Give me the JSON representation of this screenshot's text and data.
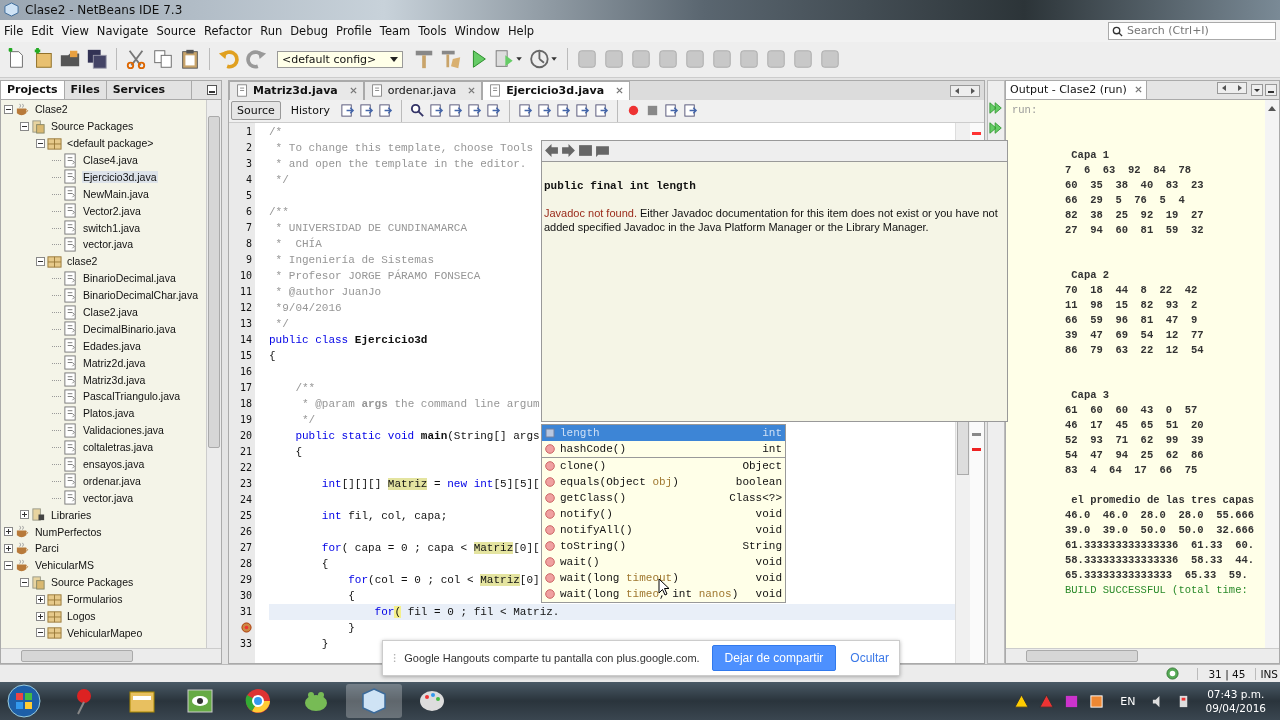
{
  "window": {
    "title": "Clase2 - NetBeans IDE 7.3"
  },
  "menu": [
    "File",
    "Edit",
    "View",
    "Navigate",
    "Source",
    "Refactor",
    "Run",
    "Debug",
    "Profile",
    "Team",
    "Tools",
    "Window",
    "Help"
  ],
  "search": {
    "placeholder": "Search (Ctrl+I)"
  },
  "toolbar": {
    "config": "<default config>"
  },
  "side_tabs": [
    {
      "label": "Projects",
      "selected": true
    },
    {
      "label": "Files",
      "selected": false
    },
    {
      "label": "Services",
      "selected": false
    }
  ],
  "tree": [
    {
      "label": "Clase2",
      "kind": "project",
      "expanded": true,
      "selected": false,
      "children": [
        {
          "label": "Source Packages",
          "kind": "sources",
          "expanded": true,
          "selected": false,
          "children": [
            {
              "label": "<default package>",
              "kind": "package",
              "expanded": true,
              "selected": false,
              "children": [
                {
                  "label": "Clase4.java",
                  "kind": "java",
                  "selected": false
                },
                {
                  "label": "Ejercicio3d.java",
                  "kind": "java",
                  "selected": true
                },
                {
                  "label": "NewMain.java",
                  "kind": "java",
                  "selected": false
                },
                {
                  "label": "Vector2.java",
                  "kind": "java",
                  "selected": false
                },
                {
                  "label": "switch1.java",
                  "kind": "java",
                  "selected": false
                },
                {
                  "label": "vector.java",
                  "kind": "java",
                  "selected": false
                }
              ]
            },
            {
              "label": "clase2",
              "kind": "package",
              "expanded": true,
              "selected": false,
              "children": [
                {
                  "label": "BinarioDecimal.java",
                  "kind": "java",
                  "selected": false
                },
                {
                  "label": "BinarioDecimalChar.java",
                  "kind": "java",
                  "selected": false
                },
                {
                  "label": "Clase2.java",
                  "kind": "java",
                  "selected": false
                },
                {
                  "label": "DecimalBinario.java",
                  "kind": "java",
                  "selected": false
                },
                {
                  "label": "Edades.java",
                  "kind": "java",
                  "selected": false
                },
                {
                  "label": "Matriz2d.java",
                  "kind": "java",
                  "selected": false
                },
                {
                  "label": "Matriz3d.java",
                  "kind": "java",
                  "selected": false
                },
                {
                  "label": "PascalTriangulo.java",
                  "kind": "java",
                  "selected": false
                },
                {
                  "label": "Platos.java",
                  "kind": "java",
                  "selected": false
                },
                {
                  "label": "Validaciones.java",
                  "kind": "java",
                  "selected": false
                },
                {
                  "label": "coltaletras.java",
                  "kind": "java",
                  "selected": false
                },
                {
                  "label": "ensayos.java",
                  "kind": "java",
                  "selected": false
                },
                {
                  "label": "ordenar.java",
                  "kind": "java",
                  "selected": false
                },
                {
                  "label": "vector.java",
                  "kind": "java",
                  "selected": false
                }
              ]
            }
          ]
        },
        {
          "label": "Libraries",
          "kind": "library",
          "expanded": false,
          "selected": false
        }
      ]
    },
    {
      "label": "NumPerfectos",
      "kind": "project",
      "expanded": false,
      "selected": false
    },
    {
      "label": "Parci",
      "kind": "project",
      "expanded": false,
      "selected": false
    },
    {
      "label": "VehicularMS",
      "kind": "project",
      "expanded": true,
      "selected": false,
      "children": [
        {
          "label": "Source Packages",
          "kind": "sources",
          "expanded": true,
          "selected": false,
          "children": [
            {
              "label": "Formularios",
              "kind": "package",
              "expanded": false,
              "selected": false
            },
            {
              "label": "Logos",
              "kind": "package",
              "expanded": false,
              "selected": false
            },
            {
              "label": "VehicularMapeo",
              "kind": "package",
              "expanded": true,
              "selected": false
            }
          ]
        }
      ]
    }
  ],
  "editor_tabs": [
    {
      "label": "Matriz3d.java",
      "selected": false
    },
    {
      "label": "ordenar.java",
      "selected": false
    },
    {
      "label": "Ejercicio3d.java",
      "selected": true
    }
  ],
  "view_tabs": [
    {
      "label": "Source",
      "selected": true
    },
    {
      "label": "History",
      "selected": false
    }
  ],
  "code": [
    {
      "number": "1",
      "error": false,
      "current": false,
      "tokens": [
        {
          "text": "/*",
          "kind": "comment"
        }
      ]
    },
    {
      "number": "2",
      "error": false,
      "current": false,
      "tokens": [
        {
          "text": " * To change this template, choose Tools",
          "kind": "comment"
        }
      ]
    },
    {
      "number": "3",
      "error": false,
      "current": false,
      "tokens": [
        {
          "text": " * and open the template in the editor.",
          "kind": "comment"
        }
      ]
    },
    {
      "number": "4",
      "error": false,
      "current": false,
      "tokens": [
        {
          "text": " */",
          "kind": "comment"
        }
      ]
    },
    {
      "number": "5",
      "error": false,
      "current": false
    },
    {
      "number": "6",
      "error": false,
      "current": false,
      "tokens": [
        {
          "text": "/**",
          "kind": "comment"
        }
      ]
    },
    {
      "number": "7",
      "error": false,
      "current": false,
      "tokens": [
        {
          "text": " * UNIVERSIDAD DE CUNDINAMARCA",
          "kind": "comment"
        }
      ]
    },
    {
      "number": "8",
      "error": false,
      "current": false,
      "tokens": [
        {
          "text": " *  CHÍA",
          "kind": "comment"
        }
      ]
    },
    {
      "number": "9",
      "error": false,
      "current": false,
      "tokens": [
        {
          "text": " * Ingeniería de Sistemas",
          "kind": "comment"
        }
      ]
    },
    {
      "number": "10",
      "error": false,
      "current": false,
      "tokens": [
        {
          "text": " * Profesor JORGE PÁRAMO FONSECA",
          "kind": "comment"
        }
      ]
    },
    {
      "number": "11",
      "error": false,
      "current": false,
      "tokens": [
        {
          "text": " * @author JuanJo",
          "kind": "comment"
        }
      ]
    },
    {
      "number": "12",
      "error": false,
      "current": false,
      "tokens": [
        {
          "text": " *9/04/2016",
          "kind": "comment"
        }
      ]
    },
    {
      "number": "13",
      "error": false,
      "current": false,
      "tokens": [
        {
          "text": " */",
          "kind": "comment"
        }
      ]
    },
    {
      "number": "14",
      "error": false,
      "current": false,
      "tokens": [
        {
          "text": "public class ",
          "kind": "keyword"
        },
        {
          "text": "Ejercicio3d",
          "kind": "bold"
        }
      ]
    },
    {
      "number": "15",
      "error": false,
      "current": false,
      "tokens": [
        {
          "text": "{",
          "kind": "plain"
        }
      ]
    },
    {
      "number": "16",
      "error": false,
      "current": false
    },
    {
      "number": "17",
      "error": false,
      "current": false,
      "tokens": [
        {
          "text": "    /**",
          "kind": "comment"
        }
      ]
    },
    {
      "number": "18",
      "error": false,
      "current": false,
      "tokens": [
        {
          "text": "     * @param ",
          "kind": "comment"
        },
        {
          "text": "args",
          "kind": "comment_bold"
        },
        {
          "text": " the command line argum",
          "kind": "comment"
        }
      ]
    },
    {
      "number": "19",
      "error": false,
      "current": false,
      "tokens": [
        {
          "text": "     */",
          "kind": "comment"
        }
      ]
    },
    {
      "number": "20",
      "error": false,
      "current": false,
      "tokens": [
        {
          "text": "    public static void ",
          "kind": "keyword"
        },
        {
          "text": "main",
          "kind": "bold"
        },
        {
          "text": "(String[] args",
          "kind": "plain"
        }
      ]
    },
    {
      "number": "21",
      "error": false,
      "current": false,
      "tokens": [
        {
          "text": "    {",
          "kind": "plain"
        }
      ]
    },
    {
      "number": "22",
      "error": false,
      "current": false
    },
    {
      "number": "23",
      "error": false,
      "current": false,
      "tokens": [
        {
          "text": "        int",
          "kind": "keyword"
        },
        {
          "text": "[][][] ",
          "kind": "plain"
        },
        {
          "text": "Matriz",
          "kind": "mark"
        },
        {
          "text": " = ",
          "kind": "plain"
        },
        {
          "text": "new int",
          "kind": "keyword"
        },
        {
          "text": "[5][5][",
          "kind": "plain"
        }
      ]
    },
    {
      "number": "24",
      "error": false,
      "current": false
    },
    {
      "number": "25",
      "error": false,
      "current": false,
      "tokens": [
        {
          "text": "        int",
          "kind": "keyword"
        },
        {
          "text": " fil, col, capa;",
          "kind": "plain"
        }
      ]
    },
    {
      "number": "26",
      "error": false,
      "current": false
    },
    {
      "number": "27",
      "error": false,
      "current": false,
      "tokens": [
        {
          "text": "        for",
          "kind": "keyword"
        },
        {
          "text": "( capa = 0 ; capa < ",
          "kind": "plain"
        },
        {
          "text": "Matriz",
          "kind": "mark"
        },
        {
          "text": "[0][",
          "kind": "plain"
        }
      ]
    },
    {
      "number": "28",
      "error": false,
      "current": false,
      "tokens": [
        {
          "text": "        {",
          "kind": "plain"
        }
      ]
    },
    {
      "number": "29",
      "error": false,
      "current": false,
      "tokens": [
        {
          "text": "            for",
          "kind": "keyword"
        },
        {
          "text": "(col = 0 ; col < ",
          "kind": "plain"
        },
        {
          "text": "Matriz",
          "kind": "mark"
        },
        {
          "text": "[0]",
          "kind": "plain"
        }
      ]
    },
    {
      "number": "30",
      "error": false,
      "current": false,
      "tokens": [
        {
          "text": "            {",
          "kind": "plain"
        }
      ]
    },
    {
      "number": "31",
      "error": false,
      "current": true,
      "tokens": [
        {
          "text": "                for",
          "kind": "keyword"
        },
        {
          "text": "(",
          "kind": "bracket"
        },
        {
          "text": " fil = 0 ; fil < Matriz.",
          "kind": "plain"
        }
      ]
    },
    {
      "error": true,
      "current": false,
      "tokens": [
        {
          "text": "            }",
          "kind": "plain"
        }
      ]
    },
    {
      "number": "33",
      "error": false,
      "current": false,
      "tokens": [
        {
          "text": "        }",
          "kind": "plain"
        }
      ]
    }
  ],
  "javadoc": {
    "signature": "public final int length",
    "warning": "Javadoc not found.",
    "message": "Either Javadoc documentation for this item does not exist or you have not added specified Javadoc in the Java Platform Manager or the Library Manager."
  },
  "completion": [
    {
      "kind": "field",
      "parts": [
        {
          "text": "length",
          "kind": "name"
        }
      ],
      "type": "int",
      "selected": true
    },
    {
      "kind": "method",
      "parts": [
        {
          "text": "hashCode()",
          "kind": "name"
        }
      ],
      "type": "int",
      "selected": false
    },
    {
      "kind": "method",
      "parts": [
        {
          "text": "clone()",
          "kind": "name"
        }
      ],
      "type": "Object",
      "selected": false
    },
    {
      "kind": "method",
      "parts": [
        {
          "text": "equals(Object ",
          "kind": "name"
        },
        {
          "text": "obj",
          "kind": "param"
        },
        {
          "text": ")",
          "kind": "name"
        }
      ],
      "type": "boolean",
      "selected": false
    },
    {
      "kind": "method",
      "parts": [
        {
          "text": "getClass()",
          "kind": "name"
        }
      ],
      "type": "Class<?>",
      "selected": false
    },
    {
      "kind": "method",
      "parts": [
        {
          "text": "notify()",
          "kind": "name"
        }
      ],
      "type": "void",
      "selected": false
    },
    {
      "kind": "method",
      "parts": [
        {
          "text": "notifyAll()",
          "kind": "name"
        }
      ],
      "type": "void",
      "selected": false
    },
    {
      "kind": "method",
      "parts": [
        {
          "text": "toString()",
          "kind": "name"
        }
      ],
      "type": "String",
      "selected": false
    },
    {
      "kind": "method",
      "parts": [
        {
          "text": "wait()",
          "kind": "name"
        }
      ],
      "type": "void",
      "selected": false
    },
    {
      "kind": "method",
      "parts": [
        {
          "text": "wait(long ",
          "kind": "name"
        },
        {
          "text": "timeout",
          "kind": "param"
        },
        {
          "text": ")",
          "kind": "name"
        }
      ],
      "type": "void",
      "selected": false
    },
    {
      "kind": "method",
      "parts": [
        {
          "text": "wait(long ",
          "kind": "name"
        },
        {
          "text": "timeo",
          "kind": "param"
        },
        {
          "text": ", int ",
          "kind": "name"
        },
        {
          "text": "nanos",
          "kind": "param"
        },
        {
          "text": ")",
          "kind": "name"
        }
      ],
      "type": "void",
      "selected": false
    }
  ],
  "output": {
    "tab": "Output - Clase2 (run)",
    "blocks": [
      {
        "kind": "log",
        "lines": [
          {
            "text": "run:",
            "kind": "normal"
          }
        ]
      },
      {
        "kind": "table",
        "lines": [
          {
            "text": " Capa 1",
            "kind": "normal"
          },
          {
            "text": "7  6  63  92  84  78",
            "kind": "normal"
          },
          {
            "text": "60  35  38  40  83  23",
            "kind": "normal"
          },
          {
            "text": "66  29  5  76  5  4",
            "kind": "normal"
          },
          {
            "text": "82  38  25  92  19  27",
            "kind": "normal"
          },
          {
            "text": "27  94  60  81  59  32",
            "kind": "normal"
          }
        ]
      },
      {
        "kind": "table",
        "lines": [
          {
            "text": " Capa 2",
            "kind": "normal"
          },
          {
            "text": "70  18  44  8  22  42",
            "kind": "normal"
          },
          {
            "text": "11  98  15  82  93  2",
            "kind": "normal"
          },
          {
            "text": "66  59  96  81  47  9",
            "kind": "normal"
          },
          {
            "text": "39  47  69  54  12  77",
            "kind": "normal"
          },
          {
            "text": "86  79  63  22  12  54",
            "kind": "normal"
          }
        ]
      },
      {
        "kind": "table",
        "lines": [
          {
            "text": " Capa 3",
            "kind": "normal"
          },
          {
            "text": "61  60  60  43  0  57",
            "kind": "normal"
          },
          {
            "text": "46  17  45  65  51  20",
            "kind": "normal"
          },
          {
            "text": "52  93  71  62  99  39",
            "kind": "normal"
          },
          {
            "text": "54  47  94  25  62  86",
            "kind": "normal"
          },
          {
            "text": "83  4  64  17  66  75",
            "kind": "normal"
          }
        ]
      },
      {
        "kind": "table",
        "lines": [
          {
            "text": " el promedio de las tres capas",
            "kind": "normal"
          },
          {
            "text": "46.0  46.0  28.0  28.0  55.666",
            "kind": "normal"
          },
          {
            "text": "39.0  39.0  50.0  50.0  32.666",
            "kind": "normal"
          },
          {
            "text": "61.333333333333336  61.33  60.",
            "kind": "normal"
          },
          {
            "text": "58.333333333333336  58.33  44.",
            "kind": "normal"
          },
          {
            "text": "65.33333333333333  65.33  59.",
            "kind": "normal"
          },
          {
            "text": "BUILD SUCCESSFUL (total time:",
            "kind": "success"
          }
        ]
      }
    ]
  },
  "hangouts": {
    "message": "Google Hangouts comparte tu pantalla con plus.google.com.",
    "stop_button": "Dejar de compartir",
    "hide_link": "Ocultar"
  },
  "status_bar": {
    "position": "31 | 45",
    "mode": "INS"
  },
  "taskbar": {
    "language": "EN",
    "time": "07:43 p.m.",
    "date": "09/04/2016"
  }
}
